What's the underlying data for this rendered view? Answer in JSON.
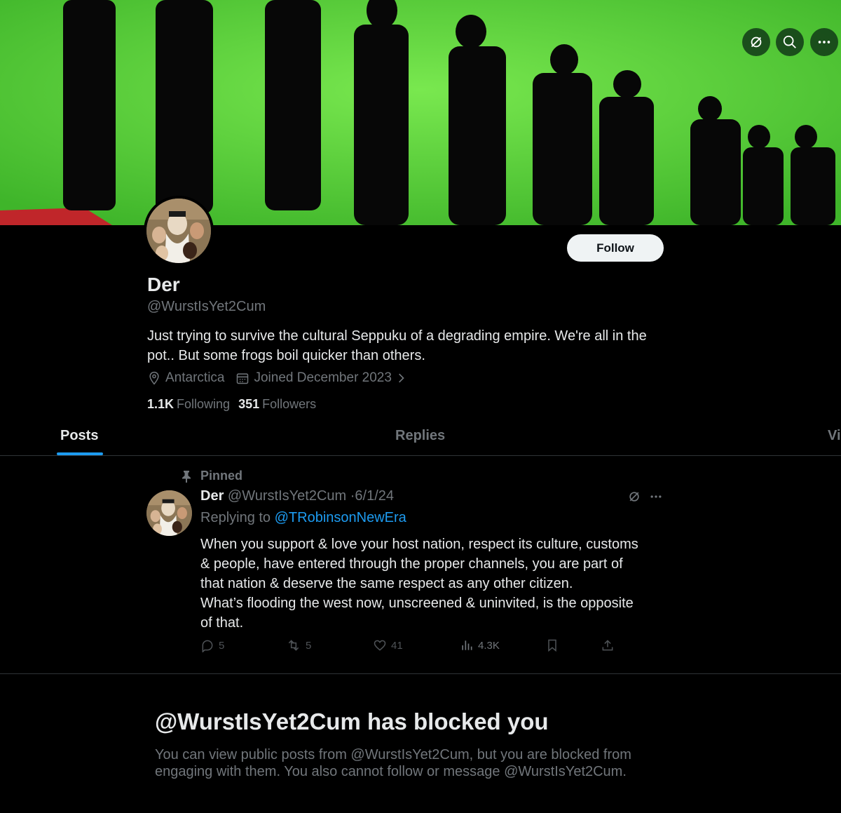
{
  "header": {
    "buttons": [
      {
        "icon": "grok-icon"
      },
      {
        "icon": "search-icon"
      },
      {
        "icon": "more-icon"
      }
    ]
  },
  "profile": {
    "display_name": "Der",
    "handle": "@WurstIsYet2Cum",
    "follow_label": "Follow",
    "bio": "Just trying to survive the cultural Seppuku of a degrading empire. We're all in the pot.. But some frogs boil quicker than others.",
    "location": "Antarctica",
    "joined": "Joined December 2023",
    "following_count": "1.1K",
    "following_label": "Following",
    "followers_count": "351",
    "followers_label": "Followers"
  },
  "tabs": [
    {
      "label": "Posts",
      "active": true
    },
    {
      "label": "Replies",
      "active": false
    },
    {
      "label": "Vi",
      "active": false
    }
  ],
  "post": {
    "pinned_label": "Pinned",
    "name": "Der",
    "handle": "@WurstIsYet2Cum",
    "date": "6/1/24",
    "replying_prefix": "Replying to",
    "replying_to": "@TRobinsonNewEra",
    "text_lines": [
      "When you support & love your host nation, respect its culture, customs",
      "& people, have entered through the proper channels, you are part of",
      "that nation & deserve the same respect as any other citizen.",
      "What’s flooding the west now, unscreened & uninvited, is the opposite",
      "of that."
    ],
    "replies": "5",
    "reposts": "5",
    "likes": "41",
    "views": "4.3K"
  },
  "blocked": {
    "title": "@WurstIsYet2Cum has blocked you",
    "description": "You can view public posts from @WurstIsYet2Cum, but you are blocked from engaging with them. You also cannot follow or message @WurstIsYet2Cum."
  },
  "colors": {
    "background": "#000000",
    "banner_green": "#5ed63a",
    "accent": "#1d9bf0",
    "secondary_text": "#71767b",
    "primary_text": "#e7e9ea"
  }
}
